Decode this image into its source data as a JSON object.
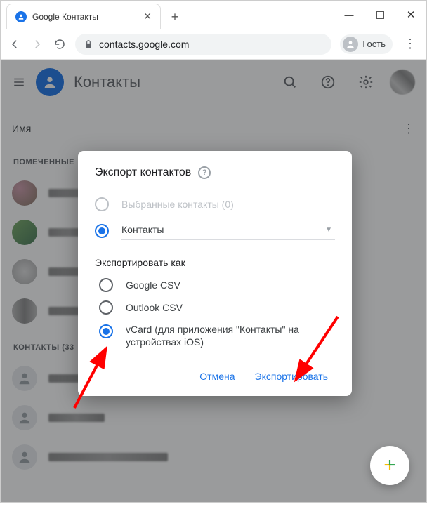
{
  "window": {
    "tab_title": "Google Контакты",
    "guest_label": "Гость"
  },
  "address": {
    "url": "contacts.google.com"
  },
  "app": {
    "title": "Контакты",
    "col_name": "Имя",
    "section_starred": "ПОМЕЧЕННЫЕ",
    "section_contacts": "КОНТАКТЫ (33"
  },
  "dialog": {
    "title": "Экспорт контактов",
    "opt_selected": "Выбранные контакты (0)",
    "dropdown_value": "Контакты",
    "section_export_as": "Экспортировать как",
    "fmt_google": "Google CSV",
    "fmt_outlook": "Outlook CSV",
    "fmt_vcard": "vCard (для приложения \"Контакты\" на устройствах iOS)",
    "btn_cancel": "Отмена",
    "btn_export": "Экспортировать"
  }
}
